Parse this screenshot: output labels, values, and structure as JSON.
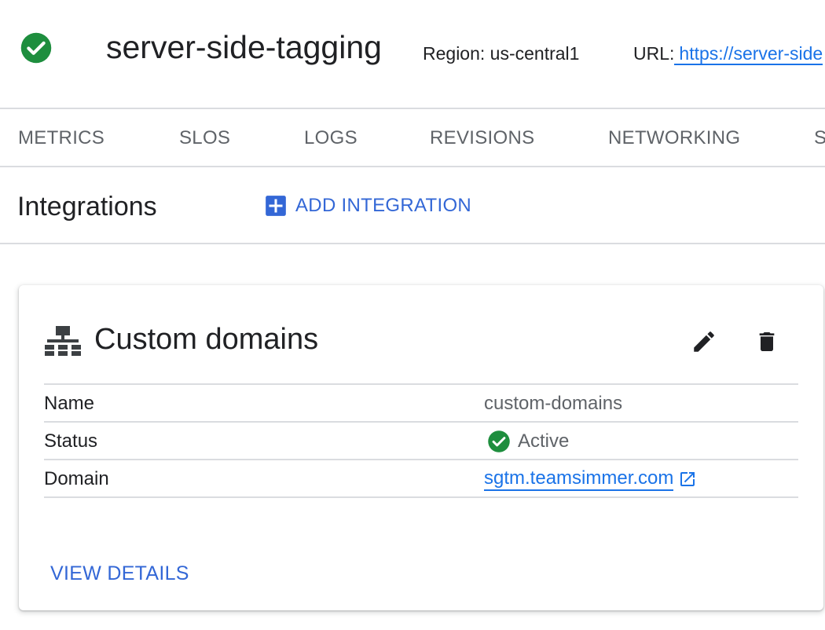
{
  "header": {
    "status_icon": "check-circle-icon",
    "service_name": "server-side-tagging",
    "region": "Region: us-central1",
    "url_label": "URL:",
    "url_link": "https://server-side",
    "colors": {
      "success": "#1e8e3e",
      "link": "#1a73e8"
    }
  },
  "tabs": [
    {
      "label": "METRICS"
    },
    {
      "label": "SLOS"
    },
    {
      "label": "LOGS"
    },
    {
      "label": "REVISIONS"
    },
    {
      "label": "NETWORKING"
    },
    {
      "label": "S"
    }
  ],
  "integrations": {
    "title": "Integrations",
    "add_button_label": "ADD INTEGRATION",
    "add_button_icon": "plus-box-icon"
  },
  "card": {
    "icon": "sitemap-icon",
    "title": "Custom domains",
    "edit_icon": "pencil-icon",
    "delete_icon": "trash-icon",
    "rows": [
      {
        "key": "Name",
        "value": "custom-domains"
      },
      {
        "key": "Status",
        "value": "Active",
        "icon": "check-circle-icon"
      },
      {
        "key": "Domain",
        "value": "sgtm.teamsimmer.com",
        "icon": "open-in-new-icon"
      }
    ],
    "view_details_label": "VIEW DETAILS"
  }
}
